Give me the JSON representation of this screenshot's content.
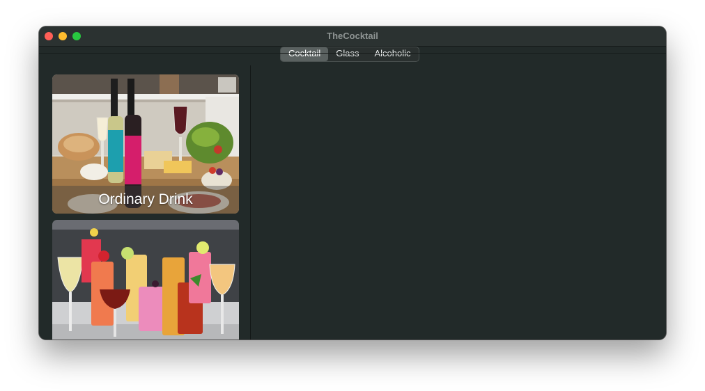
{
  "window": {
    "title": "TheCocktail"
  },
  "tabs": [
    {
      "label": "Cocktail",
      "selected": true
    },
    {
      "label": "Glass",
      "selected": false
    },
    {
      "label": "Alcoholic",
      "selected": false
    }
  ],
  "sidebar": {
    "cards": [
      {
        "label": "Ordinary Drink",
        "image": "wine-bottles-cheese-table-photo"
      },
      {
        "label": "",
        "image": "colorful-cocktails-row-photo"
      }
    ]
  },
  "colors": {
    "window_bg": "#222a29",
    "titlebar_bg": "#2b3231",
    "close": "#fe5f57",
    "minimize": "#febc2e",
    "maximize": "#28c840"
  }
}
